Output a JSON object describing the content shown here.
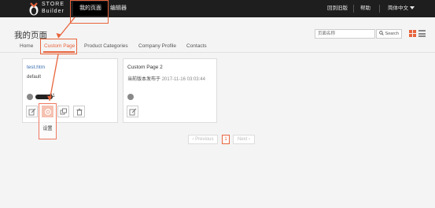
{
  "topbar": {
    "logo_top": "STORE",
    "logo_bottom": "Builder",
    "nav_mypage": "我的页面",
    "nav_editor": "编辑器",
    "nav_old": "回到旧版",
    "nav_help": "帮助",
    "nav_lang": "简体中文"
  },
  "header": {
    "title": "我的页面",
    "search_placeholder": "页面名称",
    "search_button": "Search"
  },
  "tabs": [
    "Home",
    "Custom Page",
    "Product Categories",
    "Company Profile",
    "Contacts"
  ],
  "cards": [
    {
      "name": "test.htm",
      "subtitle": "default",
      "owner": "01"
    },
    {
      "name": "Custom Page 2",
      "subtitle": "当前版本发布于",
      "timestamp": "2017-11-16 03:03:44"
    }
  ],
  "tooltip": "设置",
  "pager": {
    "prev": "Previous",
    "current": "1",
    "next": "Next"
  },
  "colors": {
    "accent": "#e8643c",
    "topbar": "#1e1e1e",
    "link": "#3a6fb0"
  }
}
